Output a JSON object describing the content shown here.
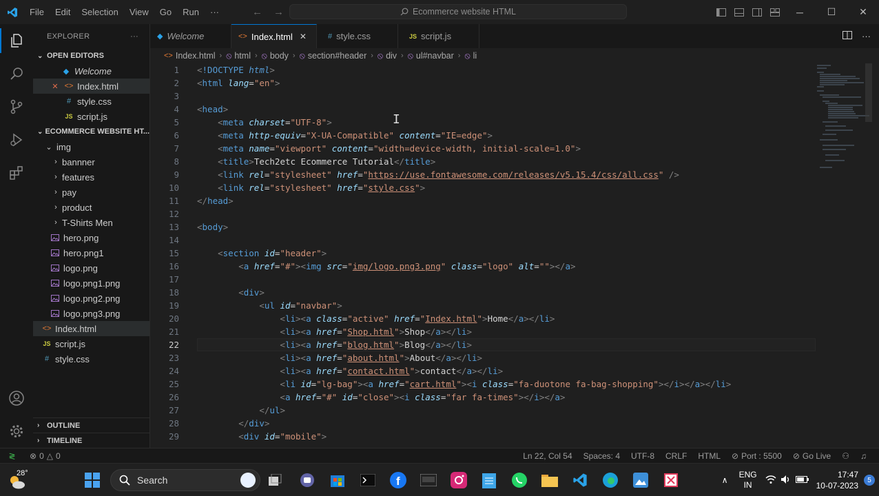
{
  "titlebar": {
    "menu": [
      "File",
      "Edit",
      "Selection",
      "View",
      "Go",
      "Run",
      "···"
    ],
    "command_center": "Ecommerce website HTML"
  },
  "explorer": {
    "header": "EXPLORER",
    "open_editors_label": "OPEN EDITORS",
    "open_editors": [
      {
        "name": "Welcome",
        "icon": "vscode-icon"
      },
      {
        "name": "Index.html",
        "icon": "html-icon",
        "close": "✕"
      },
      {
        "name": "style.css",
        "icon": "css-icon"
      },
      {
        "name": "script.js",
        "icon": "js-icon"
      }
    ],
    "project_label": "ECOMMERCE WEBSITE HT...",
    "tree": [
      {
        "name": "img",
        "type": "folder-open"
      },
      {
        "name": "bannner",
        "type": "folder"
      },
      {
        "name": "features",
        "type": "folder"
      },
      {
        "name": "pay",
        "type": "folder"
      },
      {
        "name": "product",
        "type": "folder"
      },
      {
        "name": "T-Shirts Men",
        "type": "folder"
      },
      {
        "name": "hero.png",
        "type": "image"
      },
      {
        "name": "hero.png1",
        "type": "image"
      },
      {
        "name": "logo.png",
        "type": "image"
      },
      {
        "name": "logo.png1.png",
        "type": "image"
      },
      {
        "name": "logo.png2.png",
        "type": "image"
      },
      {
        "name": "logo.png3.png",
        "type": "image"
      },
      {
        "name": "Index.html",
        "type": "html"
      },
      {
        "name": "script.js",
        "type": "js"
      },
      {
        "name": "style.css",
        "type": "css"
      }
    ],
    "outline_label": "OUTLINE",
    "timeline_label": "TIMELINE"
  },
  "tabs": [
    {
      "label": "Welcome",
      "icon": "vscode-icon"
    },
    {
      "label": "Index.html",
      "icon": "html-icon",
      "close": "✕"
    },
    {
      "label": "style.css",
      "icon": "css-icon"
    },
    {
      "label": "script.js",
      "icon": "js-icon"
    }
  ],
  "breadcrumb": [
    "Index.html",
    "html",
    "body",
    "section#header",
    "div",
    "ul#navbar",
    "li"
  ],
  "editor": {
    "current_line": 22,
    "lines": [
      {
        "n": 1,
        "html": "<span class='p'>&lt;</span><span class='t'>!DOCTYPE</span> <span class='kw'>html</span><span class='p'>&gt;</span>"
      },
      {
        "n": 2,
        "html": "<span class='p'>&lt;</span><span class='t'>html</span> <span class='a'>lang</span><span class='w'>=</span><span class='s'>\"en\"</span><span class='p'>&gt;</span>"
      },
      {
        "n": 3,
        "html": ""
      },
      {
        "n": 4,
        "html": "<span class='p'>&lt;</span><span class='t'>head</span><span class='p'>&gt;</span>"
      },
      {
        "n": 5,
        "html": "    <span class='p'>&lt;</span><span class='t'>meta</span> <span class='a'>charset</span><span class='w'>=</span><span class='s'>\"UTF-8\"</span><span class='p'>&gt;</span>"
      },
      {
        "n": 6,
        "html": "    <span class='p'>&lt;</span><span class='t'>meta</span> <span class='a'>http-equiv</span><span class='w'>=</span><span class='s'>\"X-UA-Compatible\"</span> <span class='a'>content</span><span class='w'>=</span><span class='s'>\"IE=edge\"</span><span class='p'>&gt;</span>"
      },
      {
        "n": 7,
        "html": "    <span class='p'>&lt;</span><span class='t'>meta</span> <span class='a'>name</span><span class='w'>=</span><span class='s'>\"viewport\"</span> <span class='a'>content</span><span class='w'>=</span><span class='s'>\"width=device-width, initial-scale=1.0\"</span><span class='p'>&gt;</span>"
      },
      {
        "n": 8,
        "html": "    <span class='p'>&lt;</span><span class='t'>title</span><span class='p'>&gt;</span><span class='w'>Tech2etc Ecommerce Tutorial</span><span class='p'>&lt;/</span><span class='t'>title</span><span class='p'>&gt;</span>"
      },
      {
        "n": 9,
        "html": "    <span class='p'>&lt;</span><span class='t'>link</span> <span class='a'>rel</span><span class='w'>=</span><span class='s'>\"stylesheet\"</span> <span class='a'>href</span><span class='w'>=</span><span class='s'>\"</span><span class='u'>https://use.fontawesome.com/releases/v5.15.4/css/all.css</span><span class='s'>\"</span> <span class='p'>/&gt;</span>"
      },
      {
        "n": 10,
        "html": "    <span class='p'>&lt;</span><span class='t'>link</span> <span class='a'>rel</span><span class='w'>=</span><span class='s'>\"stylesheet\"</span> <span class='a'>href</span><span class='w'>=</span><span class='s'>\"</span><span class='u'>style.css</span><span class='s'>\"</span><span class='p'>&gt;</span>"
      },
      {
        "n": 11,
        "html": "<span class='p'>&lt;/</span><span class='t'>head</span><span class='p'>&gt;</span>"
      },
      {
        "n": 12,
        "html": ""
      },
      {
        "n": 13,
        "html": "<span class='p'>&lt;</span><span class='t'>body</span><span class='p'>&gt;</span>"
      },
      {
        "n": 14,
        "html": ""
      },
      {
        "n": 15,
        "html": "    <span class='p'>&lt;</span><span class='t'>section</span> <span class='a'>id</span><span class='w'>=</span><span class='s'>\"header\"</span><span class='p'>&gt;</span>"
      },
      {
        "n": 16,
        "html": "        <span class='p'>&lt;</span><span class='t'>a</span> <span class='a'>href</span><span class='w'>=</span><span class='s'>\"#\"</span><span class='p'>&gt;&lt;</span><span class='t'>img</span> <span class='a'>src</span><span class='w'>=</span><span class='s'>\"</span><span class='u'>img/logo.png3.png</span><span class='s'>\"</span> <span class='a'>class</span><span class='w'>=</span><span class='s'>\"logo\"</span> <span class='a'>alt</span><span class='w'>=</span><span class='s'>\"\"</span><span class='p'>&gt;&lt;/</span><span class='t'>a</span><span class='p'>&gt;</span>"
      },
      {
        "n": 17,
        "html": ""
      },
      {
        "n": 18,
        "html": "        <span class='p'>&lt;</span><span class='t'>div</span><span class='p'>&gt;</span>"
      },
      {
        "n": 19,
        "html": "            <span class='p'>&lt;</span><span class='t'>ul</span> <span class='a'>id</span><span class='w'>=</span><span class='s'>\"navbar\"</span><span class='p'>&gt;</span>"
      },
      {
        "n": 20,
        "html": "                <span class='p'>&lt;</span><span class='t'>li</span><span class='p'>&gt;&lt;</span><span class='t'>a</span> <span class='a'>class</span><span class='w'>=</span><span class='s'>\"active\"</span> <span class='a'>href</span><span class='w'>=</span><span class='s'>\"</span><span class='u'>Index.html</span><span class='s'>\"</span><span class='p'>&gt;</span><span class='w'>Home</span><span class='p'>&lt;/</span><span class='t'>a</span><span class='p'>&gt;&lt;/</span><span class='t'>li</span><span class='p'>&gt;</span>"
      },
      {
        "n": 21,
        "html": "                <span class='p'>&lt;</span><span class='t'>li</span><span class='p'>&gt;&lt;</span><span class='t'>a</span> <span class='a'>href</span><span class='w'>=</span><span class='s'>\"</span><span class='u'>Shop.html</span><span class='s'>\"</span><span class='p'>&gt;</span><span class='w'>Shop</span><span class='p'>&lt;/</span><span class='t'>a</span><span class='p'>&gt;&lt;/</span><span class='t'>li</span><span class='p'>&gt;</span>"
      },
      {
        "n": 22,
        "html": "                <span class='p'>&lt;</span><span class='t'>li</span><span class='p'>&gt;&lt;</span><span class='t'>a</span> <span class='a'>href</span><span class='w'>=</span><span class='s'>\"</span><span class='u'>blog.html</span><span class='s'>\"</span><span class='p'>&gt;</span><span class='w'>Blog</span><span class='p'>&lt;/</span><span class='t'>a</span><span class='p'>&gt;&lt;/</span><span class='t'>li</span><span class='p'>&gt;</span>"
      },
      {
        "n": 23,
        "html": "                <span class='p'>&lt;</span><span class='t'>li</span><span class='p'>&gt;&lt;</span><span class='t'>a</span> <span class='a'>href</span><span class='w'>=</span><span class='s'>\"</span><span class='u'>about.html</span><span class='s'>\"</span><span class='p'>&gt;</span><span class='w'>About</span><span class='p'>&lt;/</span><span class='t'>a</span><span class='p'>&gt;&lt;/</span><span class='t'>li</span><span class='p'>&gt;</span>"
      },
      {
        "n": 24,
        "html": "                <span class='p'>&lt;</span><span class='t'>li</span><span class='p'>&gt;&lt;</span><span class='t'>a</span> <span class='a'>href</span><span class='w'>=</span><span class='s'>\"</span><span class='u'>contact.html</span><span class='s'>\"</span><span class='p'>&gt;</span><span class='w'>contact</span><span class='p'>&lt;/</span><span class='t'>a</span><span class='p'>&gt;&lt;/</span><span class='t'>li</span><span class='p'>&gt;</span>"
      },
      {
        "n": 25,
        "html": "                <span class='p'>&lt;</span><span class='t'>li</span> <span class='a'>id</span><span class='w'>=</span><span class='s'>\"lg-bag\"</span><span class='p'>&gt;&lt;</span><span class='t'>a</span> <span class='a'>href</span><span class='w'>=</span><span class='s'>\"</span><span class='u'>cart.html</span><span class='s'>\"</span><span class='p'>&gt;&lt;</span><span class='t'>i</span> <span class='a'>class</span><span class='w'>=</span><span class='s'>\"fa-duotone fa-bag-shopping\"</span><span class='p'>&gt;&lt;/</span><span class='t'>i</span><span class='p'>&gt;&lt;/</span><span class='t'>a</span><span class='p'>&gt;&lt;/</span><span class='t'>li</span><span class='p'>&gt;</span>"
      },
      {
        "n": 26,
        "html": "                <span class='p'>&lt;</span><span class='t'>a</span> <span class='a'>href</span><span class='w'>=</span><span class='s'>\"#\"</span> <span class='a'>id</span><span class='w'>=</span><span class='s'>\"close\"</span><span class='p'>&gt;&lt;</span><span class='t'>i</span> <span class='a'>class</span><span class='w'>=</span><span class='s'>\"far fa-times\"</span><span class='p'>&gt;&lt;/</span><span class='t'>i</span><span class='p'>&gt;&lt;/</span><span class='t'>a</span><span class='p'>&gt;</span>"
      },
      {
        "n": 27,
        "html": "            <span class='p'>&lt;/</span><span class='t'>ul</span><span class='p'>&gt;</span>"
      },
      {
        "n": 28,
        "html": "        <span class='p'>&lt;/</span><span class='t'>div</span><span class='p'>&gt;</span>"
      },
      {
        "n": 29,
        "html": "        <span class='p'>&lt;</span><span class='t'>div</span> <span class='a'>id</span><span class='w'>=</span><span class='s'>\"mobile\"</span><span class='p'>&gt;</span>"
      }
    ]
  },
  "statusbar": {
    "problems": "0",
    "warnings": "0",
    "position": "Ln 22, Col 54",
    "spaces": "Spaces: 4",
    "encoding": "UTF-8",
    "eol": "CRLF",
    "language": "HTML",
    "port": "Port : 5500",
    "golive": "Go Live"
  },
  "taskbar": {
    "temperature": "28°",
    "search_placeholder": "Search",
    "lang_line1": "ENG",
    "lang_line2": "IN",
    "time": "17:47",
    "date": "10-07-2023",
    "notifications": "5"
  },
  "colors": {
    "accent": "#0078d4",
    "tag": "#569cd6",
    "attribute": "#9cdcfe",
    "string": "#ce9178",
    "punctuation": "#808080"
  }
}
